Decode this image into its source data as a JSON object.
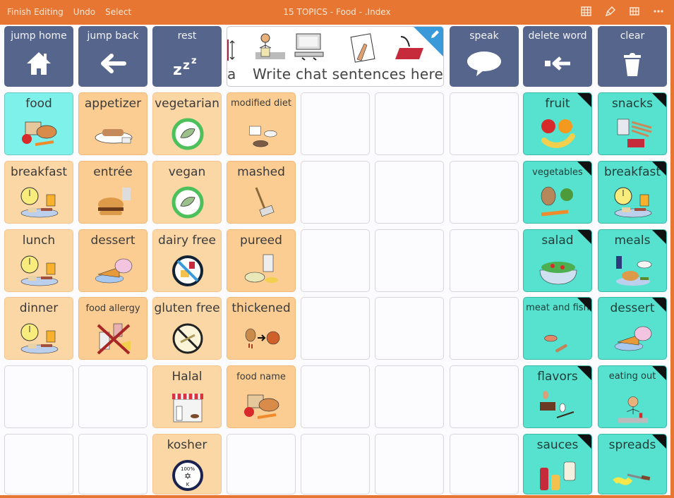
{
  "topbar": {
    "finish_editing": "Finish Editing",
    "undo": "Undo",
    "select": "Select",
    "title": "15 TOPICS - Food - .Index",
    "icons": [
      "grid-edit-icon",
      "paintbrush-icon",
      "grid-icon",
      "more-icon"
    ]
  },
  "colors": {
    "topbar": "#e77632",
    "nav_button": "#56658b",
    "folder": "#56e2cf",
    "word_peach": "#fcd7a6",
    "word_orange": "#fbcd93",
    "home_cell": "#7ef2ea",
    "edit_corner": "#3a9ad9"
  },
  "header": {
    "jump_home": "jump home",
    "jump_back": "jump back",
    "rest": "rest",
    "message_placeholder": "Write chat sentences here.",
    "message_stub": "a",
    "speak": "speak",
    "delete_word": "delete word",
    "clear": "clear"
  },
  "grid": {
    "row1": [
      "food",
      "appetizer",
      "vegetarian",
      "modified diet",
      "",
      "",
      "",
      "fruit",
      "snacks"
    ],
    "row2": [
      "breakfast",
      "entrée",
      "vegan",
      "mashed",
      "",
      "",
      "",
      "vegetables",
      "breakfast"
    ],
    "row3": [
      "lunch",
      "dessert",
      "dairy free",
      "pureed",
      "",
      "",
      "",
      "salad",
      "meals"
    ],
    "row4": [
      "dinner",
      "food allergy",
      "gluten free",
      "thickened",
      "",
      "",
      "",
      "meat and fish",
      "dessert"
    ],
    "row5": [
      "",
      "",
      "Halal",
      "food name",
      "",
      "",
      "",
      "flavors",
      "eating out"
    ],
    "row6": [
      "",
      "",
      "kosher",
      "",
      "",
      "",
      "",
      "sauces",
      "spreads"
    ]
  }
}
